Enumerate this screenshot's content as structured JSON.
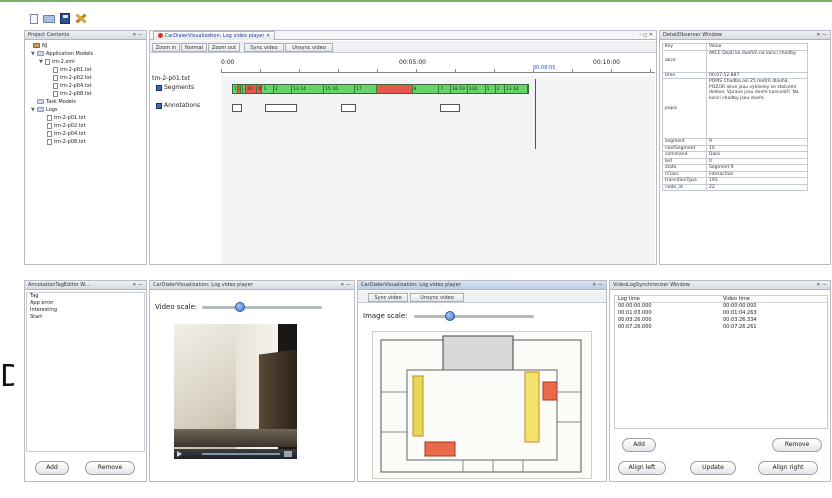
{
  "toolbar": {
    "icons": [
      "new-file-icon",
      "open-folder-icon",
      "save-icon",
      "tools-icon"
    ]
  },
  "project_contents": {
    "title": "Project Contents",
    "controls": "✕ —",
    "root": "NJ",
    "app_models": "Application Models",
    "app_file": "tm-2.xml",
    "app_children": [
      "tm-2-p01.txt",
      "tm-2-p02.txt",
      "tm-2-p04.txt",
      "tm-2-p08.txt"
    ],
    "task_models": "Task Models",
    "logs": "Logs",
    "log_children": [
      "tm-2-p01.txt",
      "tm-2-p02.txt",
      "tm-2-p04.txt",
      "tm-2-p08.txt"
    ]
  },
  "player_main": {
    "title": "CarDialerVisualization: Log video player ✕",
    "window_controls": "– ◻ ✕",
    "buttons": [
      "Zoom in",
      "Normal",
      "Zoom out",
      "Sync video",
      "Unsync video"
    ],
    "ticks": [
      "0:00",
      "00:05:00",
      "00:10:00"
    ],
    "playhead_time": "00:08:05",
    "file_label": "tm-2-p01.txt",
    "segments_label": "Segments",
    "annotations_label": "Annotations",
    "segments": [
      {
        "label": "1",
        "color": "g",
        "w": 4
      },
      {
        "label": "2",
        "color": "r",
        "w": 2
      },
      {
        "label": "3",
        "color": "g",
        "w": 2
      },
      {
        "label": "4",
        "color": "g",
        "w": 2
      },
      {
        "label": "10 10",
        "color": "r",
        "w": 9
      },
      {
        "label": "8",
        "color": "r",
        "w": 4
      },
      {
        "label": "1",
        "color": "g",
        "w": 9
      },
      {
        "label": "2",
        "color": "g",
        "w": 14
      },
      {
        "label": "13 14",
        "color": "g",
        "w": 25
      },
      {
        "label": "15 16",
        "color": "g",
        "w": 24
      },
      {
        "label": "17",
        "color": "g",
        "w": 17
      },
      {
        "label": "",
        "color": "r",
        "w": 28
      },
      {
        "label": "8",
        "color": "g",
        "w": 21
      },
      {
        "label": "7",
        "color": "g",
        "w": 9
      },
      {
        "label": "18 19",
        "color": "g",
        "w": 13
      },
      {
        "label": "110",
        "color": "g",
        "w": 14
      },
      {
        "label": "1",
        "color": "g",
        "w": 8
      },
      {
        "label": "2",
        "color": "g",
        "w": 7
      },
      {
        "label": "13 14",
        "color": "g",
        "w": 18
      }
    ]
  },
  "detail_window": {
    "title": "DetailObserver Window",
    "controls": "✕ —",
    "col_key": "Key",
    "col_value": "Value",
    "rows": [
      {
        "key": "akce",
        "value": "AKCE Dojdi ke dveřím na konci chodby."
      },
      {
        "key": "time",
        "value": "00:07:52.887"
      },
      {
        "key": "popis",
        "value": "POPIS Chodba asi 25 metrů dlouhá. POZOR nkve jsou výklenky se stolcemí doleva. Vpravo jsou dveře kanceláří. Na konci chodby jsou dveře."
      },
      {
        "key": "segment",
        "value": "9"
      },
      {
        "key": "nextSegment",
        "value": "10"
      },
      {
        "key": "command",
        "value": "Dalsi"
      },
      {
        "key": "led",
        "value": "0"
      },
      {
        "key": "state",
        "value": "Segment 9"
      },
      {
        "key": "rClass",
        "value": "interaction"
      },
      {
        "key": "transitionType",
        "value": "193"
      },
      {
        "key": "node_id",
        "value": "22"
      }
    ]
  },
  "tag_editor": {
    "title": "AnnotationTagEditor W...",
    "controls": "✕ —",
    "items": [
      "Tag",
      "App error",
      "Interesting",
      "Start"
    ],
    "add": "Add",
    "remove": "Remove"
  },
  "video_player": {
    "title": "CarDialerVisualization: Log video player",
    "controls": "✕ —",
    "scale_label": "Video scale:",
    "scale_value": 0.32
  },
  "image_player": {
    "title": "CarDialerVisualization: Log video player",
    "controls": "✕ —",
    "buttons": [
      "Sync video",
      "Unsync video"
    ],
    "scale_label": "Image scale:",
    "scale_value": 0.3
  },
  "sync_window": {
    "title": "VideoLogSynchronizer Window",
    "controls": "✕ —",
    "col_log": "Log time",
    "col_video": "Video time",
    "rows": [
      {
        "log": "00:00:00.000",
        "video": "00:00:00.000"
      },
      {
        "log": "00:01:03.000",
        "video": "00:01:04.263"
      },
      {
        "log": "00:03:26.000",
        "video": "00:03:26.334"
      },
      {
        "log": "00:07:26.000",
        "video": "00:07:26.261"
      }
    ],
    "add": "Add",
    "remove": "Remove",
    "align_left": "Align left",
    "update": "Update",
    "align_right": "Align right"
  },
  "side_label": "D"
}
